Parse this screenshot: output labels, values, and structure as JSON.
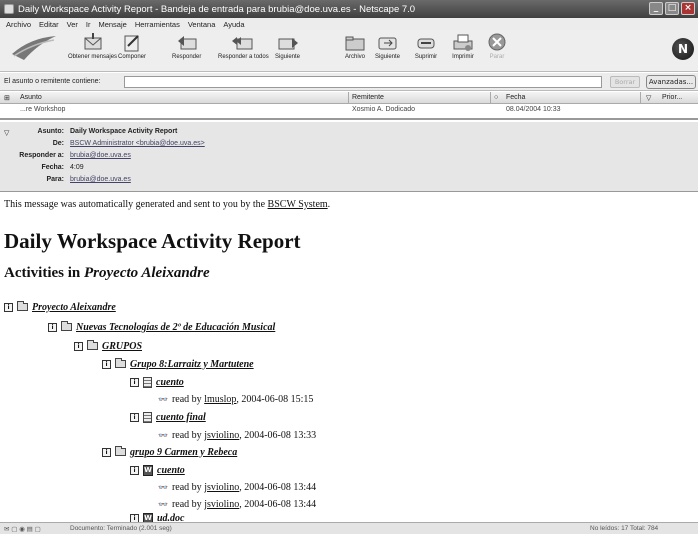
{
  "window": {
    "title": "Daily Workspace Activity Report - Bandeja de entrada para brubia@doe.uva.es - Netscape 7.0"
  },
  "menu": [
    "Archivo",
    "Editar",
    "Ver",
    "Ir",
    "Mensaje",
    "Herramientas",
    "Ventana",
    "Ayuda"
  ],
  "toolbar": {
    "get_messages": "Obtener mensajes",
    "compose": "Componer",
    "reply": "Responder",
    "reply_all": "Responder a todos",
    "forward": "Siguiente",
    "file": "Archivo",
    "next": "Siguiente",
    "delete": "Suprimir",
    "print": "Imprimir",
    "stop": "Parar"
  },
  "search": {
    "label": "El asunto o remitente contiene:",
    "value": "",
    "clear_label": "Borrar",
    "advanced_label": "Avanzadas..."
  },
  "threads": {
    "columns": {
      "subject": "Asunto",
      "sender": "Remitente",
      "date": "Fecha",
      "priority": "Prior..."
    },
    "row": {
      "subject": "...re Workshop",
      "sender": "Xosmio A. Dodicado",
      "date": "08.04/2004 10:33"
    }
  },
  "message_header": {
    "subject_label": "Asunto:",
    "subject": "Daily Workspace Activity Report",
    "from_label": "De:",
    "from": "BSCW Administrator <brubia@doe.uva.es>",
    "reply_to_label": "Responder a:",
    "reply_to": "brubia@doe.uva.es",
    "date_label": "Fecha:",
    "date": "4:09",
    "to_label": "Para:",
    "to": "brubia@doe.uva.es"
  },
  "body": {
    "intro_prefix": "This message was automatically generated and sent to you by the ",
    "intro_link": "BSCW System",
    "intro_suffix": ".",
    "heading": "Daily Workspace Activity Report",
    "subheading_prefix": "Activities in ",
    "subheading_workspace": "Proyecto Aleixandre",
    "tree": {
      "root": "Proyecto Aleixandre",
      "level1": "Nuevas Tecnologías de 2º de Educación Musical",
      "level2": "GRUPOS",
      "group8": "Grupo 8:Larraitz y Martutene",
      "g8_item1": "cuento",
      "g8_item1_reader": "lmuslop",
      "g8_item1_time": ", 2004-06-08 15:15",
      "g8_item2": "cuento final",
      "g8_item2_reader": "jsviolino",
      "g8_item2_time": ", 2004-06-08 13:33",
      "group9": "grupo 9 Carmen y Rebeca",
      "g9_item1": "cuento",
      "g9_item1_read1_reader": "jsviolino",
      "g9_item1_read1_time": ", 2004-06-08 13:44",
      "g9_item1_read2_reader": "jsviolino",
      "g9_item1_read2_time": ", 2004-06-08 13:44",
      "g9_item2": "ud.doc",
      "read_prefix": "read by "
    },
    "info_glyph": "i",
    "word_glyph": "W",
    "glasses_glyph": "👓"
  },
  "statusbar": {
    "left": "Documento: Terminado (2.001 seg)",
    "right": "No leídos: 17   Total: 784"
  }
}
